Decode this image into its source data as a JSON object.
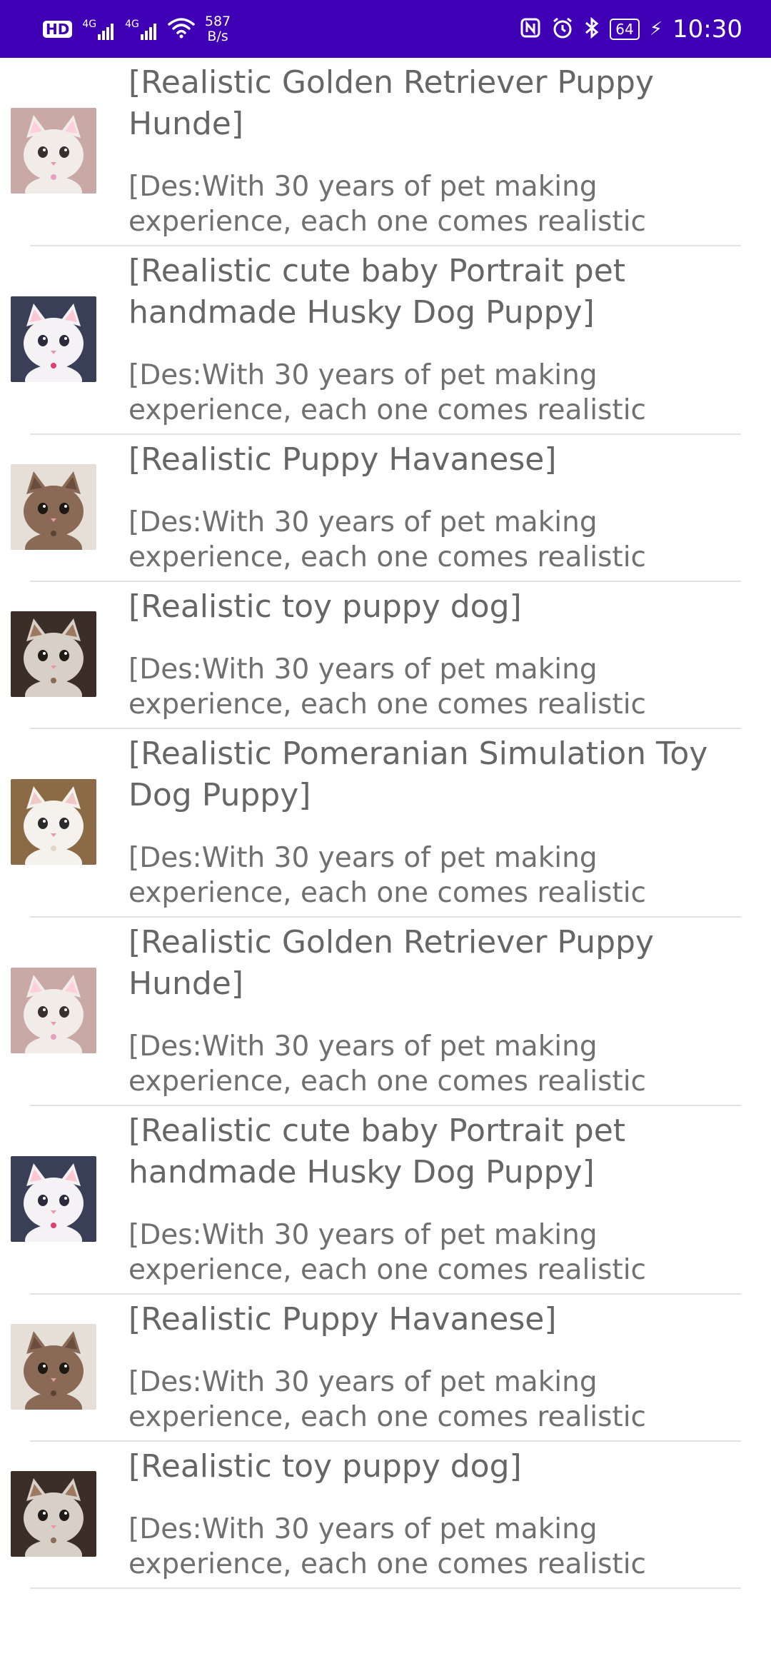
{
  "status_bar": {
    "hd_label": "HD",
    "sim1_label": "4G",
    "sim2_label": "4G",
    "net_speed_value": "587",
    "net_speed_unit": "B/s",
    "battery_level": "64",
    "time": "10:30",
    "icons": [
      "hd-icon",
      "signal-icon",
      "signal-icon",
      "wifi-icon",
      "nfc-icon",
      "alarm-icon",
      "bluetooth-icon",
      "battery-icon",
      "charging-icon"
    ]
  },
  "items": [
    {
      "title": "[Realistic Golden Retriever Puppy Hunde]",
      "desc": "[Des:With 30 years of pet making experience, each one comes realistic",
      "thumb": {
        "bg": "#c9a9a6",
        "body": "#f2ece9",
        "ear": "#ffd0dc",
        "eye": "#3a2f2f",
        "accent": "#e7a1c0"
      }
    },
    {
      "title": "[Realistic cute baby Portrait pet handmade Husky Dog Puppy]",
      "desc": "[Des:With 30 years of pet making experience, each one comes realistic",
      "thumb": {
        "bg": "#3a3f58",
        "body": "#f4f2f4",
        "ear": "#ffc6d3",
        "eye": "#2a2a3a",
        "accent": "#e33c6f"
      }
    },
    {
      "title": "[Realistic Puppy Havanese]",
      "desc": "[Des:With 30 years of pet making experience, each one comes realistic",
      "thumb": {
        "bg": "#e6dfd8",
        "body": "#8a6a56",
        "ear": "#6a4e3d",
        "eye": "#1e1812",
        "accent": "#5b4435"
      }
    },
    {
      "title": "[Realistic toy puppy dog]",
      "desc": "[Des:With 30 years of pet making experience, each one comes realistic",
      "thumb": {
        "bg": "#3b2e27",
        "body": "#d8cfc6",
        "ear": "#9c7a61",
        "eye": "#1f1b17",
        "accent": "#8a6b55"
      }
    },
    {
      "title": "[Realistic Pomeranian Simulation Toy Dog Puppy]",
      "desc": "[Des:With 30 years of pet making experience, each one comes realistic",
      "thumb": {
        "bg": "#8b6a45",
        "body": "#f5f1ec",
        "ear": "#f0c8c8",
        "eye": "#2b2b2b",
        "accent": "#e0d6c9"
      }
    },
    {
      "title": "[Realistic Golden Retriever Puppy Hunde]",
      "desc": "[Des:With 30 years of pet making experience, each one comes realistic",
      "thumb": {
        "bg": "#c9a9a6",
        "body": "#f2ece9",
        "ear": "#ffd0dc",
        "eye": "#3a2f2f",
        "accent": "#e7a1c0"
      }
    },
    {
      "title": "[Realistic cute baby Portrait pet handmade Husky Dog Puppy]",
      "desc": "[Des:With 30 years of pet making experience, each one comes realistic",
      "thumb": {
        "bg": "#3a3f58",
        "body": "#f4f2f4",
        "ear": "#ffc6d3",
        "eye": "#2a2a3a",
        "accent": "#e33c6f"
      }
    },
    {
      "title": "[Realistic Puppy Havanese]",
      "desc": "[Des:With 30 years of pet making experience, each one comes realistic",
      "thumb": {
        "bg": "#e6dfd8",
        "body": "#8a6a56",
        "ear": "#6a4e3d",
        "eye": "#1e1812",
        "accent": "#5b4435"
      }
    },
    {
      "title": "[Realistic toy puppy dog]",
      "desc": "[Des:With 30 years of pet making experience, each one comes realistic",
      "thumb": {
        "bg": "#3b2e27",
        "body": "#d8cfc6",
        "ear": "#9c7a61",
        "eye": "#1f1b17",
        "accent": "#8a6b55"
      }
    }
  ],
  "colors": {
    "status_bar_bg": "#3F00B5",
    "title_text": "#666666",
    "desc_text": "#707070",
    "divider": "#e2e2e2"
  }
}
